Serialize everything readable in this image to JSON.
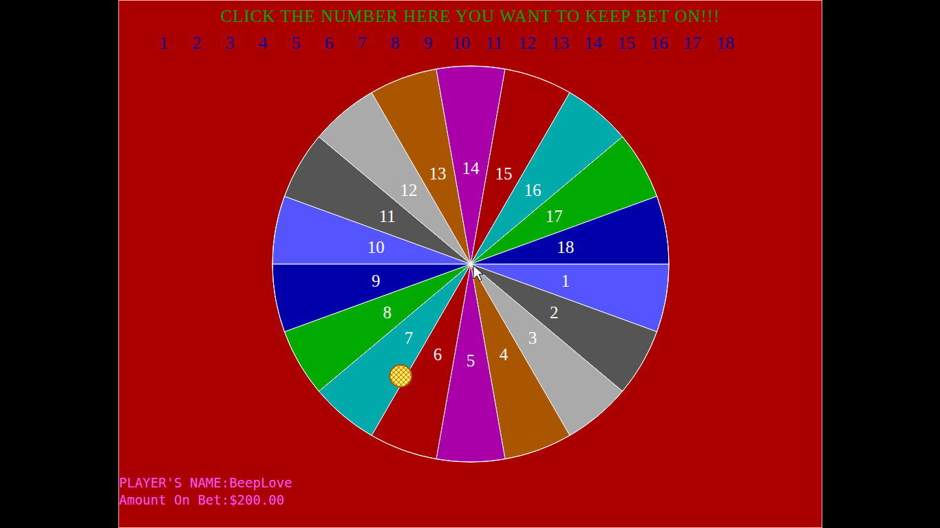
{
  "title": "CLICK THE NUMBER HERE YOU WANT TO KEEP BET ON!!!",
  "bet_numbers": [
    "1",
    "2",
    "3",
    "4",
    "5",
    "6",
    "7",
    "8",
    "9",
    "10",
    "11",
    "12",
    "13",
    "14",
    "15",
    "16",
    "17",
    "18"
  ],
  "wheel": {
    "segments": [
      {
        "label": "1",
        "color": "#5555ff",
        "ball": false
      },
      {
        "label": "2",
        "color": "#555555",
        "ball": false
      },
      {
        "label": "3",
        "color": "#aaaaaa",
        "ball": false
      },
      {
        "label": "4",
        "color": "#aa5500",
        "ball": false
      },
      {
        "label": "5",
        "color": "#aa00aa",
        "ball": false
      },
      {
        "label": "6",
        "color": "#aa0000",
        "ball": false
      },
      {
        "label": "7",
        "color": "#00aaaa",
        "ball": true
      },
      {
        "label": "8",
        "color": "#00aa00",
        "ball": false
      },
      {
        "label": "9",
        "color": "#0000aa",
        "ball": false
      },
      {
        "label": "10",
        "color": "#5555ff",
        "ball": false
      },
      {
        "label": "11",
        "color": "#555555",
        "ball": false
      },
      {
        "label": "12",
        "color": "#aaaaaa",
        "ball": false
      },
      {
        "label": "13",
        "color": "#aa5500",
        "ball": false
      },
      {
        "label": "14",
        "color": "#aa00aa",
        "ball": false
      },
      {
        "label": "15",
        "color": "#aa0000",
        "ball": false
      },
      {
        "label": "16",
        "color": "#00aaaa",
        "ball": false
      },
      {
        "label": "17",
        "color": "#00aa00",
        "ball": false
      },
      {
        "label": "18",
        "color": "#0000aa",
        "ball": false
      }
    ]
  },
  "player": {
    "name_label": "PLAYER'S NAME:",
    "name": "BeepLove",
    "bet_label": "Amount On Bet:",
    "bet": "$200.00"
  }
}
